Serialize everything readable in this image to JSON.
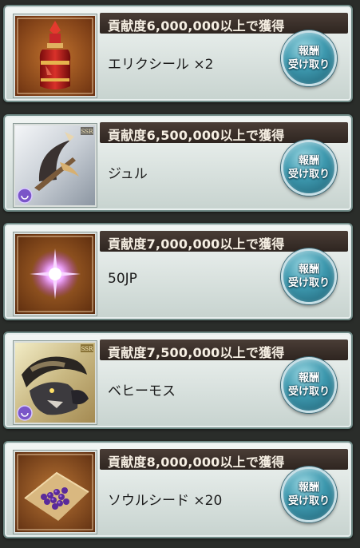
{
  "rewards": [
    {
      "header": "貢献度6,000,000以上で獲得",
      "item": "エリクシール ×2",
      "button_line1": "報酬",
      "button_line2": "受け取り",
      "icon": "elixir-bottle-icon"
    },
    {
      "header": "貢献度6,500,000以上で獲得",
      "item": "ジュル",
      "button_line1": "報酬",
      "button_line2": "受け取り",
      "icon": "jul-weapon-icon",
      "rarity": "SSR"
    },
    {
      "header": "貢献度7,000,000以上で獲得",
      "item": "50JP",
      "button_line1": "報酬",
      "button_line2": "受け取り",
      "icon": "jp-orb-icon"
    },
    {
      "header": "貢献度7,500,000以上で獲得",
      "item": "ベヒーモス",
      "button_line1": "報酬",
      "button_line2": "受け取り",
      "icon": "behemoth-summon-icon",
      "rarity": "SSR"
    },
    {
      "header": "貢献度8,000,000以上で獲得",
      "item": "ソウルシード ×20",
      "button_line1": "報酬",
      "button_line2": "受け取り",
      "icon": "soul-seed-icon"
    }
  ]
}
